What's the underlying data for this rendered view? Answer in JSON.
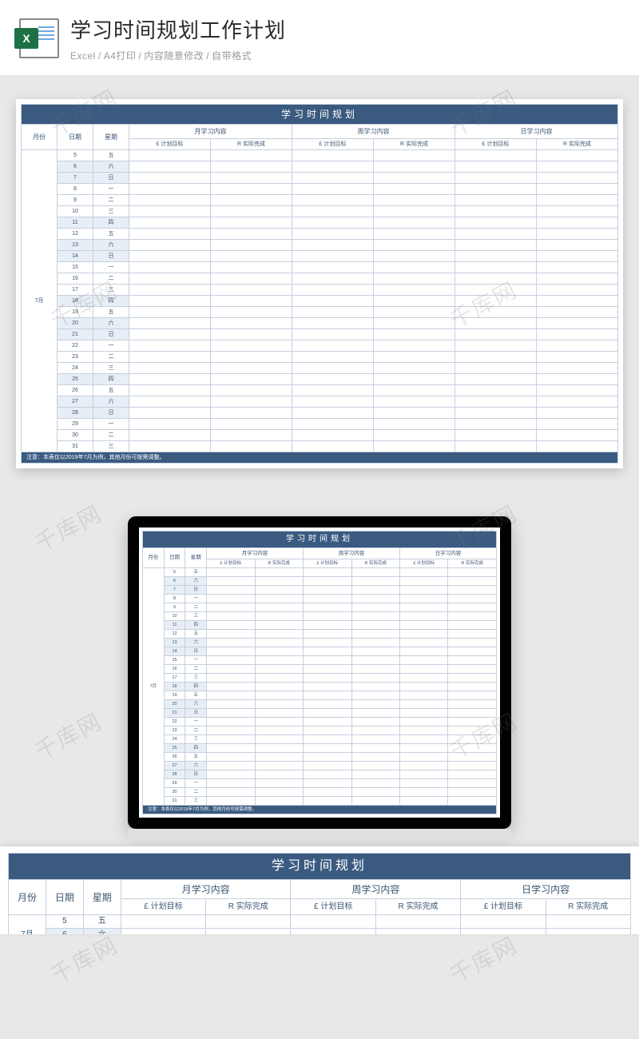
{
  "header": {
    "icon_badge": "X",
    "title": "学习时间规划工作计划",
    "subtitle_parts": [
      "Excel",
      "A4打印",
      "内容随意修改",
      "自带格式"
    ],
    "separator": "/"
  },
  "sheet": {
    "title": "学习时间规划",
    "columns": {
      "month": "月份",
      "date": "日期",
      "weekday": "星期",
      "group_month": "月学习内容",
      "group_week": "周学习内容",
      "group_day": "日学习内容",
      "plan": "£ 计划目标",
      "actual": "R 实际完成"
    },
    "month_label": "7月",
    "rows": [
      {
        "date": "5",
        "wd": "五",
        "alt": false
      },
      {
        "date": "6",
        "wd": "六",
        "alt": true
      },
      {
        "date": "7",
        "wd": "日",
        "alt": true
      },
      {
        "date": "8",
        "wd": "一",
        "alt": false
      },
      {
        "date": "9",
        "wd": "二",
        "alt": false
      },
      {
        "date": "10",
        "wd": "三",
        "alt": false
      },
      {
        "date": "11",
        "wd": "四",
        "alt": true
      },
      {
        "date": "12",
        "wd": "五",
        "alt": false
      },
      {
        "date": "13",
        "wd": "六",
        "alt": true
      },
      {
        "date": "14",
        "wd": "日",
        "alt": true
      },
      {
        "date": "15",
        "wd": "一",
        "alt": false
      },
      {
        "date": "16",
        "wd": "二",
        "alt": false
      },
      {
        "date": "17",
        "wd": "三",
        "alt": false
      },
      {
        "date": "18",
        "wd": "四",
        "alt": true
      },
      {
        "date": "19",
        "wd": "五",
        "alt": false
      },
      {
        "date": "20",
        "wd": "六",
        "alt": true
      },
      {
        "date": "21",
        "wd": "日",
        "alt": true
      },
      {
        "date": "22",
        "wd": "一",
        "alt": false
      },
      {
        "date": "23",
        "wd": "二",
        "alt": false
      },
      {
        "date": "24",
        "wd": "三",
        "alt": false
      },
      {
        "date": "25",
        "wd": "四",
        "alt": true
      },
      {
        "date": "26",
        "wd": "五",
        "alt": false
      },
      {
        "date": "27",
        "wd": "六",
        "alt": true
      },
      {
        "date": "28",
        "wd": "日",
        "alt": true
      },
      {
        "date": "29",
        "wd": "一",
        "alt": false
      },
      {
        "date": "30",
        "wd": "二",
        "alt": false
      },
      {
        "date": "31",
        "wd": "三",
        "alt": false
      }
    ],
    "footer_note": "注意：本表仅以2019年7月为例，其他月份可按需调整。"
  },
  "watermark": "千库网"
}
